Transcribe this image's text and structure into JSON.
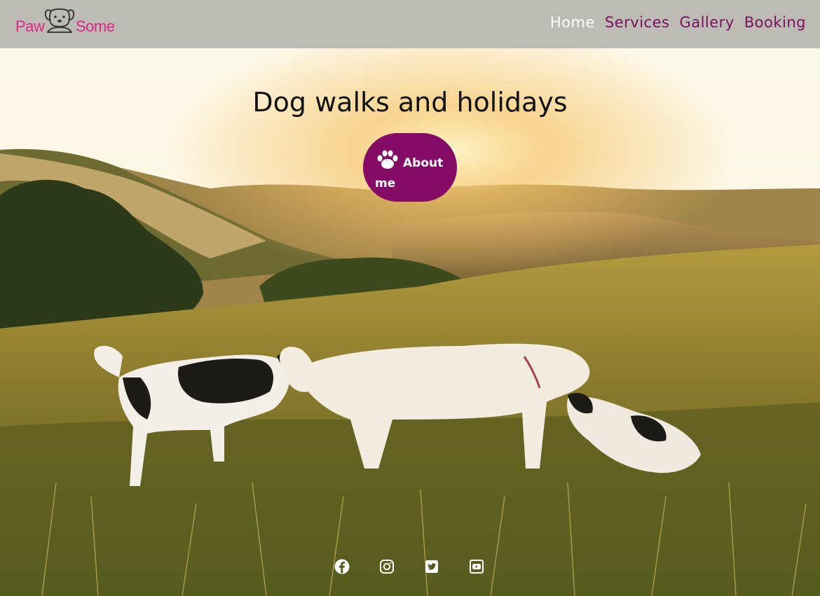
{
  "brand": {
    "left_text": "Paw",
    "right_text": "Some",
    "color": "#e0248a",
    "icon": "dog-face-icon"
  },
  "nav": {
    "items": [
      {
        "label": "Home",
        "active": true
      },
      {
        "label": "Services",
        "active": false
      },
      {
        "label": "Gallery",
        "active": false
      },
      {
        "label": "Booking",
        "active": false
      }
    ],
    "color": "#7b1060",
    "active_color": "#ffffff"
  },
  "hero": {
    "title": "Dog walks and holidays",
    "button": {
      "label": "About me",
      "icon": "paw-icon",
      "color": "#840c66"
    },
    "background": "sunset-meadow-dogs-photo"
  },
  "social": {
    "items": [
      {
        "icon": "facebook-icon"
      },
      {
        "icon": "instagram-icon"
      },
      {
        "icon": "twitter-icon"
      },
      {
        "icon": "youtube-icon"
      }
    ]
  },
  "colors": {
    "header_bg": "#bcbcb5",
    "accent": "#840c66"
  }
}
